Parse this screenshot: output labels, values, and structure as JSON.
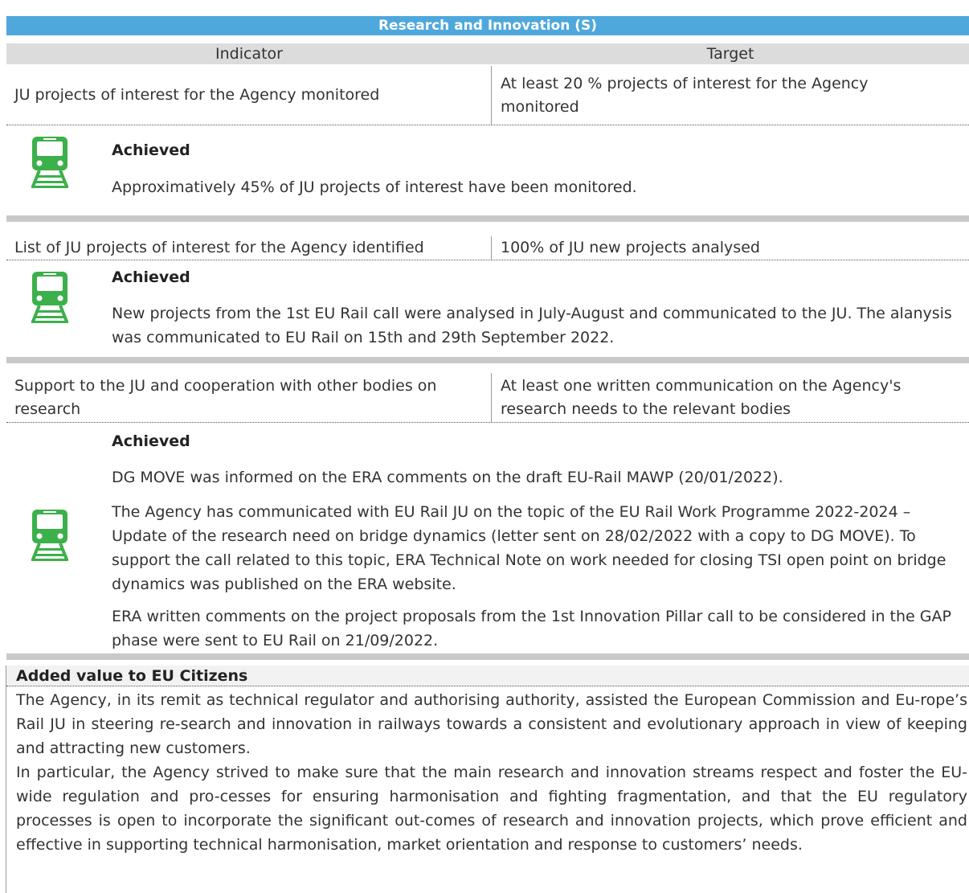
{
  "title": "Research and Innovation (S)",
  "columns": {
    "indicator": "Indicator",
    "target": "Target"
  },
  "rows": [
    {
      "indicator": "JU projects of interest for the Agency monitored",
      "target": "At least 20 % projects of interest for the Agency monitored",
      "status": "Achieved",
      "paragraphs": [
        "Approximatively 45% of JU projects of interest have been monitored."
      ]
    },
    {
      "indicator": "List of JU projects of interest for the Agency identified",
      "target": "100% of JU new projects analysed",
      "status": "Achieved",
      "paragraphs": [
        "New projects from the 1st EU Rail call were analysed in July-August and communicated to the JU.  The alanysis  was communicated to EU Rail on 15th and 29th September 2022."
      ]
    },
    {
      "indicator": "Support to the JU and cooperation with other bodies on research",
      "target": "At least one written communication on the Agency's research needs to the relevant bodies",
      "status": "Achieved",
      "paragraphs": [
        "DG MOVE was informed on the ERA comments on the draft EU-Rail MAWP (20/01/2022).",
        "The Agency has communicated with EU Rail JU on the topic of the EU Rail Work Programme 2022-2024 – Update of the research need on bridge dynamics (letter sent on 28/02/2022 with a copy to DG MOVE). To support the call related to this topic, ERA Technical Note on work needed for closing TSI open point on bridge dynamics was published on the ERA website.",
        "ERA written comments on the project proposals from the 1st Innovation Pillar call to be considered in the GAP phase were sent to EU Rail on 21/09/2022."
      ]
    }
  ],
  "added_value": {
    "heading": "Added value to EU Citizens",
    "paragraphs": [
      "The Agency, in its remit as technical regulator and authorising authority, assisted the European Commission and Eu-rope’s Rail JU in steering re-search and innovation in railways towards a consistent and evolutionary approach in view of keeping and attracting new customers.",
      "In particular, the Agency strived to make sure that the main research and innovation streams respect and foster the EU-wide regulation and pro-cesses for ensuring harmonisation and fighting fragmentation, and that the EU regulatory processes is open to incorporate the significant out-comes of research and innovation projects, which prove efficient and effective in supporting technical harmonisation, market orientation and response to customers’ needs."
    ]
  },
  "colors": {
    "header_blue": "#4ea8dc",
    "train_green": "#3cb04a",
    "separator_grey": "#c9c9c9"
  },
  "icons": [
    "train-icon"
  ]
}
